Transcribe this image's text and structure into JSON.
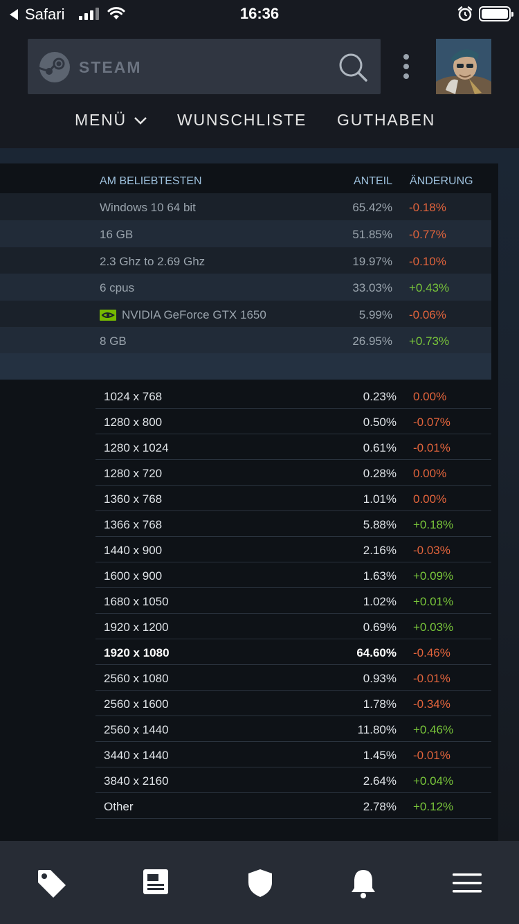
{
  "status_bar": {
    "back_label": "Safari",
    "time": "16:36"
  },
  "header": {
    "logo_text": "STEAM",
    "nav": {
      "menu": "MENÜ",
      "wishlist": "WUNSCHLISTE",
      "funds": "GUTHABEN"
    }
  },
  "popular": {
    "headers": {
      "name": "AM BELIEBTESTEN",
      "share": "ANTEIL",
      "change": "ÄNDERUNG"
    },
    "rows": [
      {
        "name": "Windows 10 64 bit",
        "share": "65.42%",
        "change": "-0.18%"
      },
      {
        "name": "16 GB",
        "share": "51.85%",
        "change": "-0.77%"
      },
      {
        "name": "2.3 Ghz to 2.69 Ghz",
        "share": "19.97%",
        "change": "-0.10%"
      },
      {
        "name": "6 cpus",
        "share": "33.03%",
        "change": "+0.43%"
      },
      {
        "name": "NVIDIA GeForce GTX 1650",
        "share": "5.99%",
        "change": "-0.06%"
      },
      {
        "name": "8 GB",
        "share": "26.95%",
        "change": "+0.73%"
      }
    ]
  },
  "resolutions": [
    {
      "name": "1024 x 768",
      "share": "0.23%",
      "change": "0.00%"
    },
    {
      "name": "1280 x 800",
      "share": "0.50%",
      "change": "-0.07%"
    },
    {
      "name": "1280 x 1024",
      "share": "0.61%",
      "change": "-0.01%"
    },
    {
      "name": "1280 x 720",
      "share": "0.28%",
      "change": "0.00%"
    },
    {
      "name": "1360 x 768",
      "share": "1.01%",
      "change": "0.00%"
    },
    {
      "name": "1366 x 768",
      "share": "5.88%",
      "change": "+0.18%"
    },
    {
      "name": "1440 x 900",
      "share": "2.16%",
      "change": "-0.03%"
    },
    {
      "name": "1600 x 900",
      "share": "1.63%",
      "change": "+0.09%"
    },
    {
      "name": "1680 x 1050",
      "share": "1.02%",
      "change": "+0.01%"
    },
    {
      "name": "1920 x 1200",
      "share": "0.69%",
      "change": "+0.03%"
    },
    {
      "name": "1920 x 1080",
      "share": "64.60%",
      "change": "-0.46%"
    },
    {
      "name": "2560 x 1080",
      "share": "0.93%",
      "change": "-0.01%"
    },
    {
      "name": "2560 x 1600",
      "share": "1.78%",
      "change": "-0.34%"
    },
    {
      "name": "2560 x 1440",
      "share": "11.80%",
      "change": "+0.46%"
    },
    {
      "name": "3440 x 1440",
      "share": "1.45%",
      "change": "-0.01%"
    },
    {
      "name": "3840 x 2160",
      "share": "2.64%",
      "change": "+0.04%"
    },
    {
      "name": "Other",
      "share": "2.78%",
      "change": "+0.12%"
    }
  ],
  "toolbar_icons": [
    "tag-icon",
    "news-icon",
    "shield-icon",
    "bell-icon",
    "menu-icon"
  ],
  "colors": {
    "negative": "#e3643c",
    "positive": "#79c63a",
    "header_text": "#9ec1dd"
  }
}
